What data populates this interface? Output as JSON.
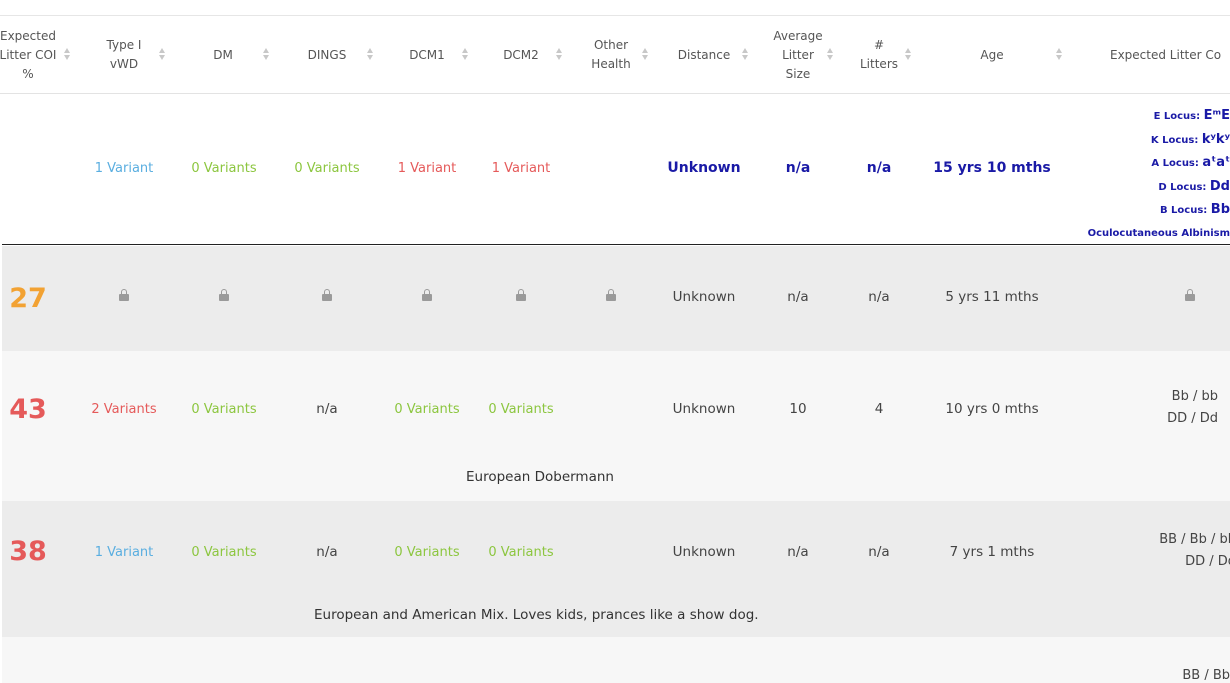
{
  "headers": [
    {
      "name": "Expected\nLitter COI\n%",
      "key": "coi"
    },
    {
      "name": "Type I\nvWD",
      "key": "vwd"
    },
    {
      "name": "DM",
      "key": "dm"
    },
    {
      "name": "DINGS",
      "key": "dings"
    },
    {
      "name": "DCM1",
      "key": "dcm1"
    },
    {
      "name": "DCM2",
      "key": "dcm2"
    },
    {
      "name": "Other\nHealth",
      "key": "other"
    },
    {
      "name": "Distance",
      "key": "distance"
    },
    {
      "name": "Average\nLitter\nSize",
      "key": "avg"
    },
    {
      "name": "#\nLitters",
      "key": "litters"
    },
    {
      "name": "Age",
      "key": "age"
    },
    {
      "name": "Expected Litter Co",
      "key": "color"
    }
  ],
  "summary_row": {
    "vwd": "1 Variant",
    "dm": "0 Variants",
    "dings": "0 Variants",
    "dcm1": "1 Variant",
    "dcm2": "1 Variant",
    "distance": "Unknown",
    "avg": "n/a",
    "litters": "n/a",
    "age": "15 yrs 10 mths",
    "loci": [
      {
        "label": "E Locus:",
        "value": "EᵐE"
      },
      {
        "label": "K Locus:",
        "value": "kʸkʸ"
      },
      {
        "label": "A Locus:",
        "value": "aᵗaᵗ"
      },
      {
        "label": "D Locus:",
        "value": "Dd"
      },
      {
        "label": "B Locus:",
        "value": "Bb"
      },
      {
        "label": "Oculocutaneous Albinism",
        "value": ""
      }
    ]
  },
  "rows": [
    {
      "coi": "27",
      "coi_color": "#f2a233",
      "distance": "Unknown",
      "avg": "n/a",
      "litters": "n/a",
      "age": "5 yrs 11 mths",
      "locked": true
    },
    {
      "coi": "43",
      "coi_color": "#e55a5a",
      "vwd": "2 Variants",
      "dm": "0 Variants",
      "dings": "n/a",
      "dcm1": "0 Variants",
      "dcm2": "0 Variants",
      "distance": "Unknown",
      "avg": "10",
      "litters": "4",
      "age": "10 yrs 0 mths",
      "colors": [
        "Bb / bb",
        "DD / Dd"
      ],
      "description": "European Dobermann"
    },
    {
      "coi": "38",
      "coi_color": "#e55a5a",
      "vwd": "1 Variant",
      "dm": "0 Variants",
      "dings": "n/a",
      "dcm1": "0 Variants",
      "dcm2": "0 Variants",
      "distance": "Unknown",
      "avg": "n/a",
      "litters": "n/a",
      "age": "7 yrs 1 mths",
      "colors": [
        "BB / Bb / bb",
        "DD / Dd"
      ],
      "description": "European and American Mix. Loves kids, prances like a show dog."
    },
    {
      "coi": "",
      "colors": [
        "BB / Bb"
      ]
    }
  ],
  "icons": {
    "lock": "lock-icon",
    "sort": "sort-arrows-icon"
  },
  "palette": {
    "variant_blue": "#5aaee0",
    "variant_green": "#8cc63f",
    "variant_red": "#e55a5a",
    "locus_navy": "#1a1aa6",
    "row_grey": "#ececec",
    "row_light": "#f7f7f7"
  }
}
